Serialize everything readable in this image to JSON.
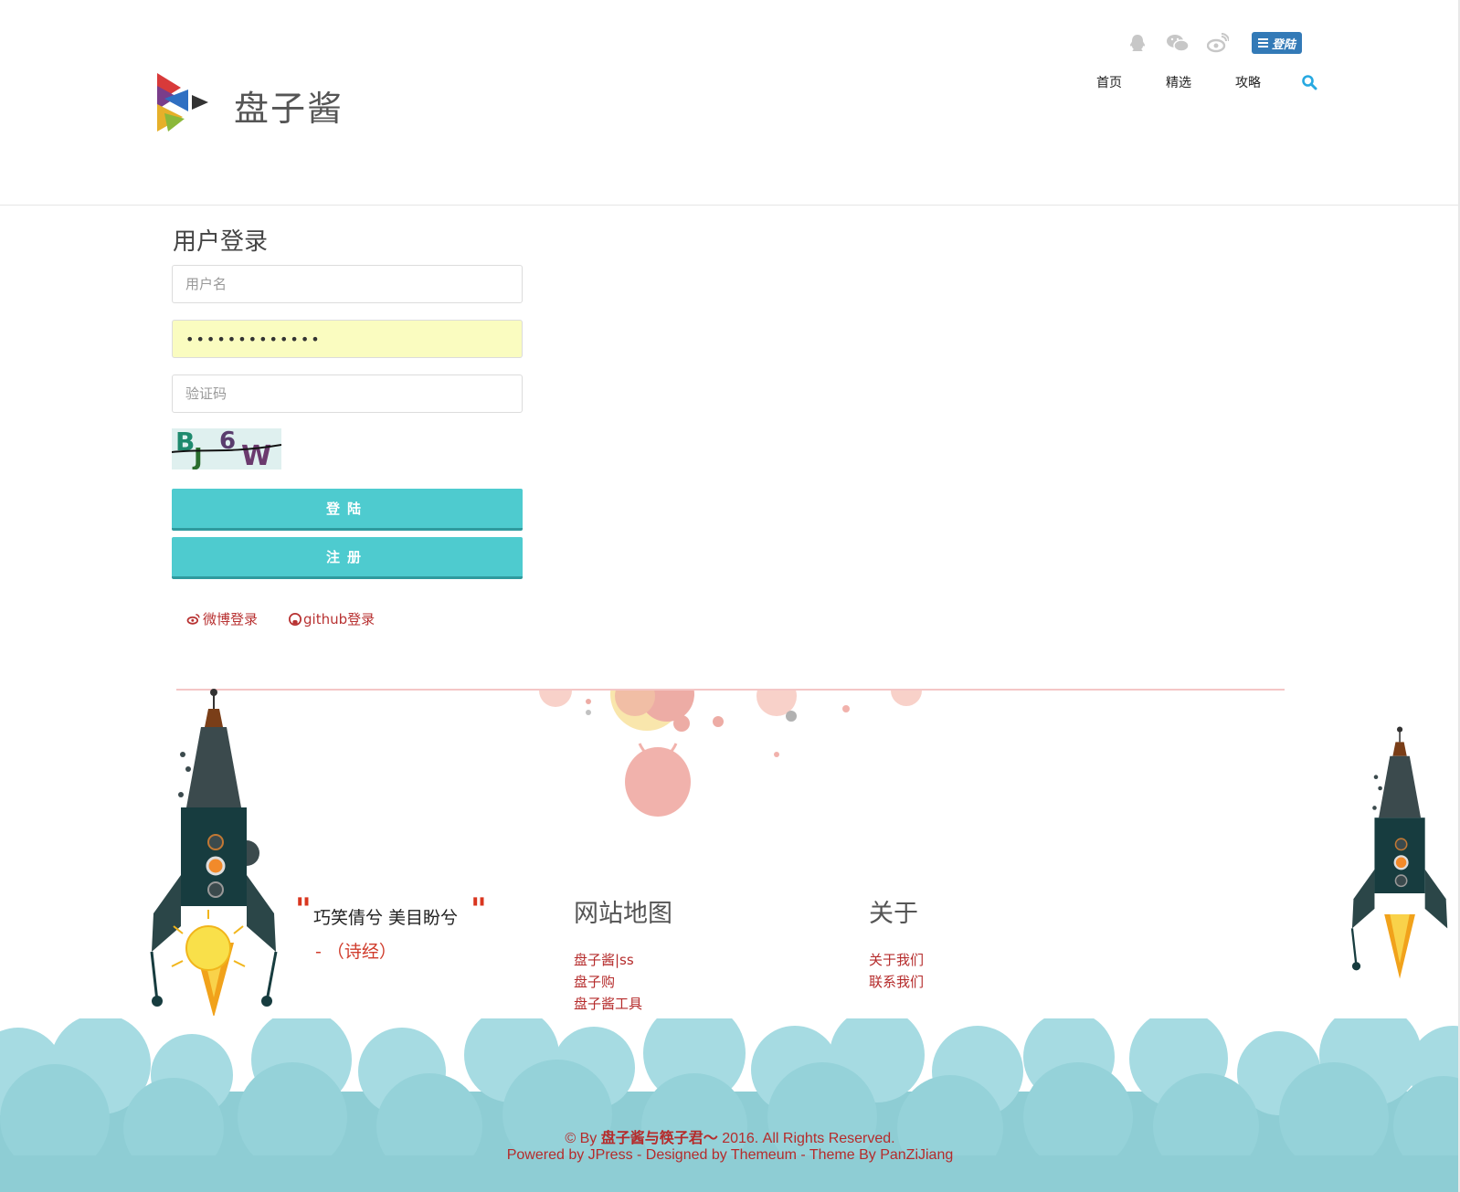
{
  "header": {
    "site_name": "盘子酱",
    "social_icons": [
      "qq-icon",
      "wechat-icon",
      "weibo-icon"
    ],
    "login_badge": "登陆",
    "nav": [
      "首页",
      "精选",
      "攻略"
    ],
    "accent_color": "#27a9e1"
  },
  "login_form": {
    "title": "用户登录",
    "username_placeholder": "用户名",
    "password_value": "•••••••••••••",
    "captcha_placeholder": "验证码",
    "captcha_text": "BJ6W",
    "login_button": "登陆",
    "register_button": "注册",
    "weibo_login": "微博登录",
    "github_login": "github登录",
    "button_color": "#4ecbcf"
  },
  "footer": {
    "quote": "巧笑倩兮 美目盼兮",
    "quote_source": "- （诗经）",
    "sitemap_title": "网站地图",
    "sitemap_links": [
      "盘子酱|ss",
      "盘子购",
      "盘子酱工具"
    ],
    "about_title": "关于",
    "about_links": [
      "关于我们",
      "联系我们"
    ],
    "copyright_prefix": "© By ",
    "copyright_owner": "盘子酱与筷子君～",
    "copyright_suffix": " 2016. All Rights Reserved.",
    "powered": "Powered by JPress - Designed by Themeum - Theme By PanZiJiang",
    "link_color": "#b52b2b",
    "cloud_color": "#8ecdd4"
  }
}
